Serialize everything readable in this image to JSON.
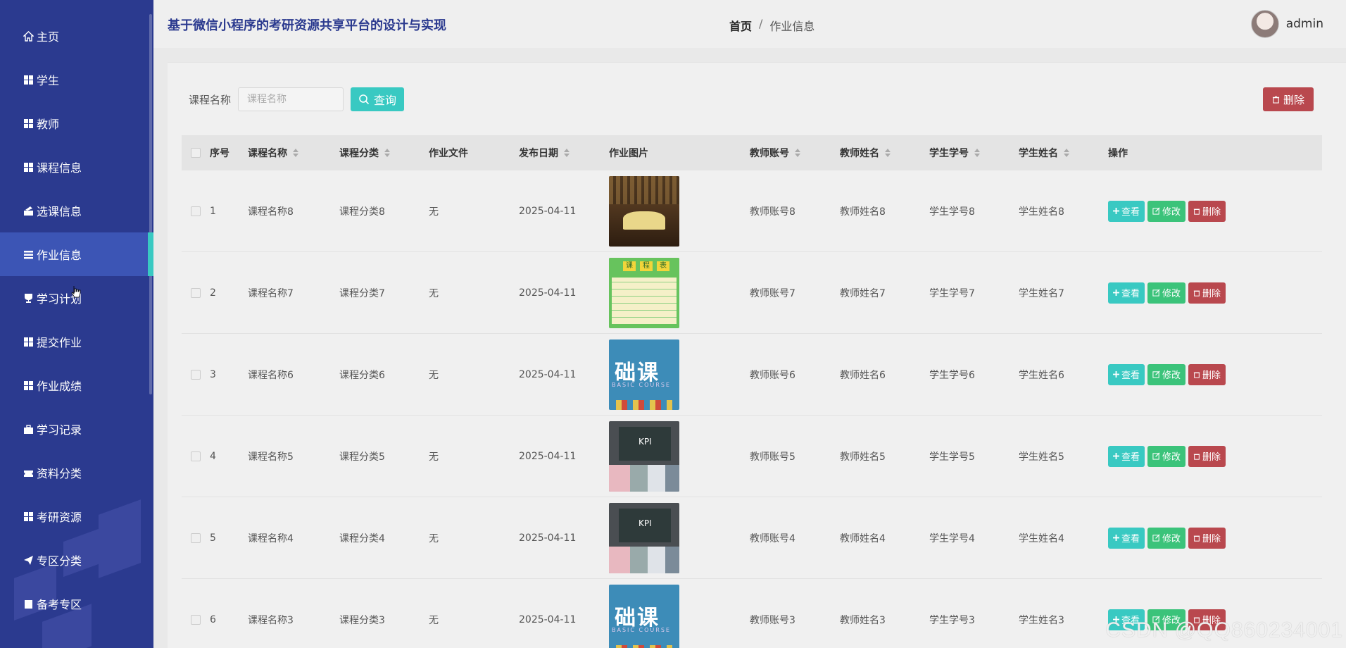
{
  "app_title": "基于微信小程序的考研资源共享平台的设计与实现",
  "breadcrumb": {
    "home": "首页",
    "separator": "/",
    "current": "作业信息"
  },
  "user": {
    "name": "admin"
  },
  "sidebar": {
    "items": [
      {
        "label": "主页",
        "icon": "home-icon"
      },
      {
        "label": "学生",
        "icon": "grid-icon"
      },
      {
        "label": "教师",
        "icon": "grid-icon"
      },
      {
        "label": "课程信息",
        "icon": "grid-icon"
      },
      {
        "label": "选课信息",
        "icon": "stack-icon"
      },
      {
        "label": "作业信息",
        "icon": "list-icon",
        "active": true
      },
      {
        "label": "学习计划",
        "icon": "trophy-icon"
      },
      {
        "label": "提交作业",
        "icon": "grid-icon"
      },
      {
        "label": "作业成绩",
        "icon": "grid-icon"
      },
      {
        "label": "学习记录",
        "icon": "briefcase-icon"
      },
      {
        "label": "资料分类",
        "icon": "ticket-icon"
      },
      {
        "label": "考研资源",
        "icon": "grid-icon"
      },
      {
        "label": "专区分类",
        "icon": "send-icon"
      },
      {
        "label": "备考专区",
        "icon": "building-icon"
      }
    ]
  },
  "search": {
    "label": "课程名称",
    "placeholder": "课程名称",
    "button": "查询"
  },
  "toolbar": {
    "delete_label": "删除"
  },
  "table": {
    "headers": {
      "index": "序号",
      "course_name": "课程名称",
      "course_category": "课程分类",
      "homework_file": "作业文件",
      "publish_date": "发布日期",
      "homework_image": "作业图片",
      "teacher_account": "教师账号",
      "teacher_name": "教师姓名",
      "student_no": "学生学号",
      "student_name": "学生姓名",
      "actions": "操作"
    },
    "actions": {
      "view": "查看",
      "edit": "修改",
      "delete": "删除"
    },
    "rows": [
      {
        "index": "1",
        "course_name": "课程名称8",
        "course_category": "课程分类8",
        "homework_file": "无",
        "publish_date": "2025-04-11",
        "image": "book",
        "teacher_account": "教师账号8",
        "teacher_name": "教师姓名8",
        "student_no": "学生学号8",
        "student_name": "学生姓名8"
      },
      {
        "index": "2",
        "course_name": "课程名称7",
        "course_category": "课程分类7",
        "homework_file": "无",
        "publish_date": "2025-04-11",
        "image": "schedule",
        "teacher_account": "教师账号7",
        "teacher_name": "教师姓名7",
        "student_no": "学生学号7",
        "student_name": "学生姓名7"
      },
      {
        "index": "3",
        "course_name": "课程名称6",
        "course_category": "课程分类6",
        "homework_file": "无",
        "publish_date": "2025-04-11",
        "image": "basic",
        "teacher_account": "教师账号6",
        "teacher_name": "教师姓名6",
        "student_no": "学生学号6",
        "student_name": "学生姓名6"
      },
      {
        "index": "4",
        "course_name": "课程名称5",
        "course_category": "课程分类5",
        "homework_file": "无",
        "publish_date": "2025-04-11",
        "image": "kpi",
        "teacher_account": "教师账号5",
        "teacher_name": "教师姓名5",
        "student_no": "学生学号5",
        "student_name": "学生姓名5"
      },
      {
        "index": "5",
        "course_name": "课程名称4",
        "course_category": "课程分类4",
        "homework_file": "无",
        "publish_date": "2025-04-11",
        "image": "kpi",
        "teacher_account": "教师账号4",
        "teacher_name": "教师姓名4",
        "student_no": "学生学号4",
        "student_name": "学生姓名4"
      },
      {
        "index": "6",
        "course_name": "课程名称3",
        "course_category": "课程分类3",
        "homework_file": "无",
        "publish_date": "2025-04-11",
        "image": "basic",
        "teacher_account": "教师账号3",
        "teacher_name": "教师姓名3",
        "student_no": "学生学号3",
        "student_name": "学生姓名3"
      }
    ]
  },
  "thumb_text": {
    "schedule": [
      "课",
      "程",
      "表"
    ],
    "basic_big": "础课",
    "basic_small": "BASIC COURSE",
    "kpi": "KPI"
  },
  "watermark": "CSDN @QQ860234001",
  "colors": {
    "sidebar": "#2b3a8f",
    "active_item": "#3c55b5",
    "accent": "#39c9c2",
    "edit": "#3bc37a",
    "danger": "#b9484e"
  }
}
